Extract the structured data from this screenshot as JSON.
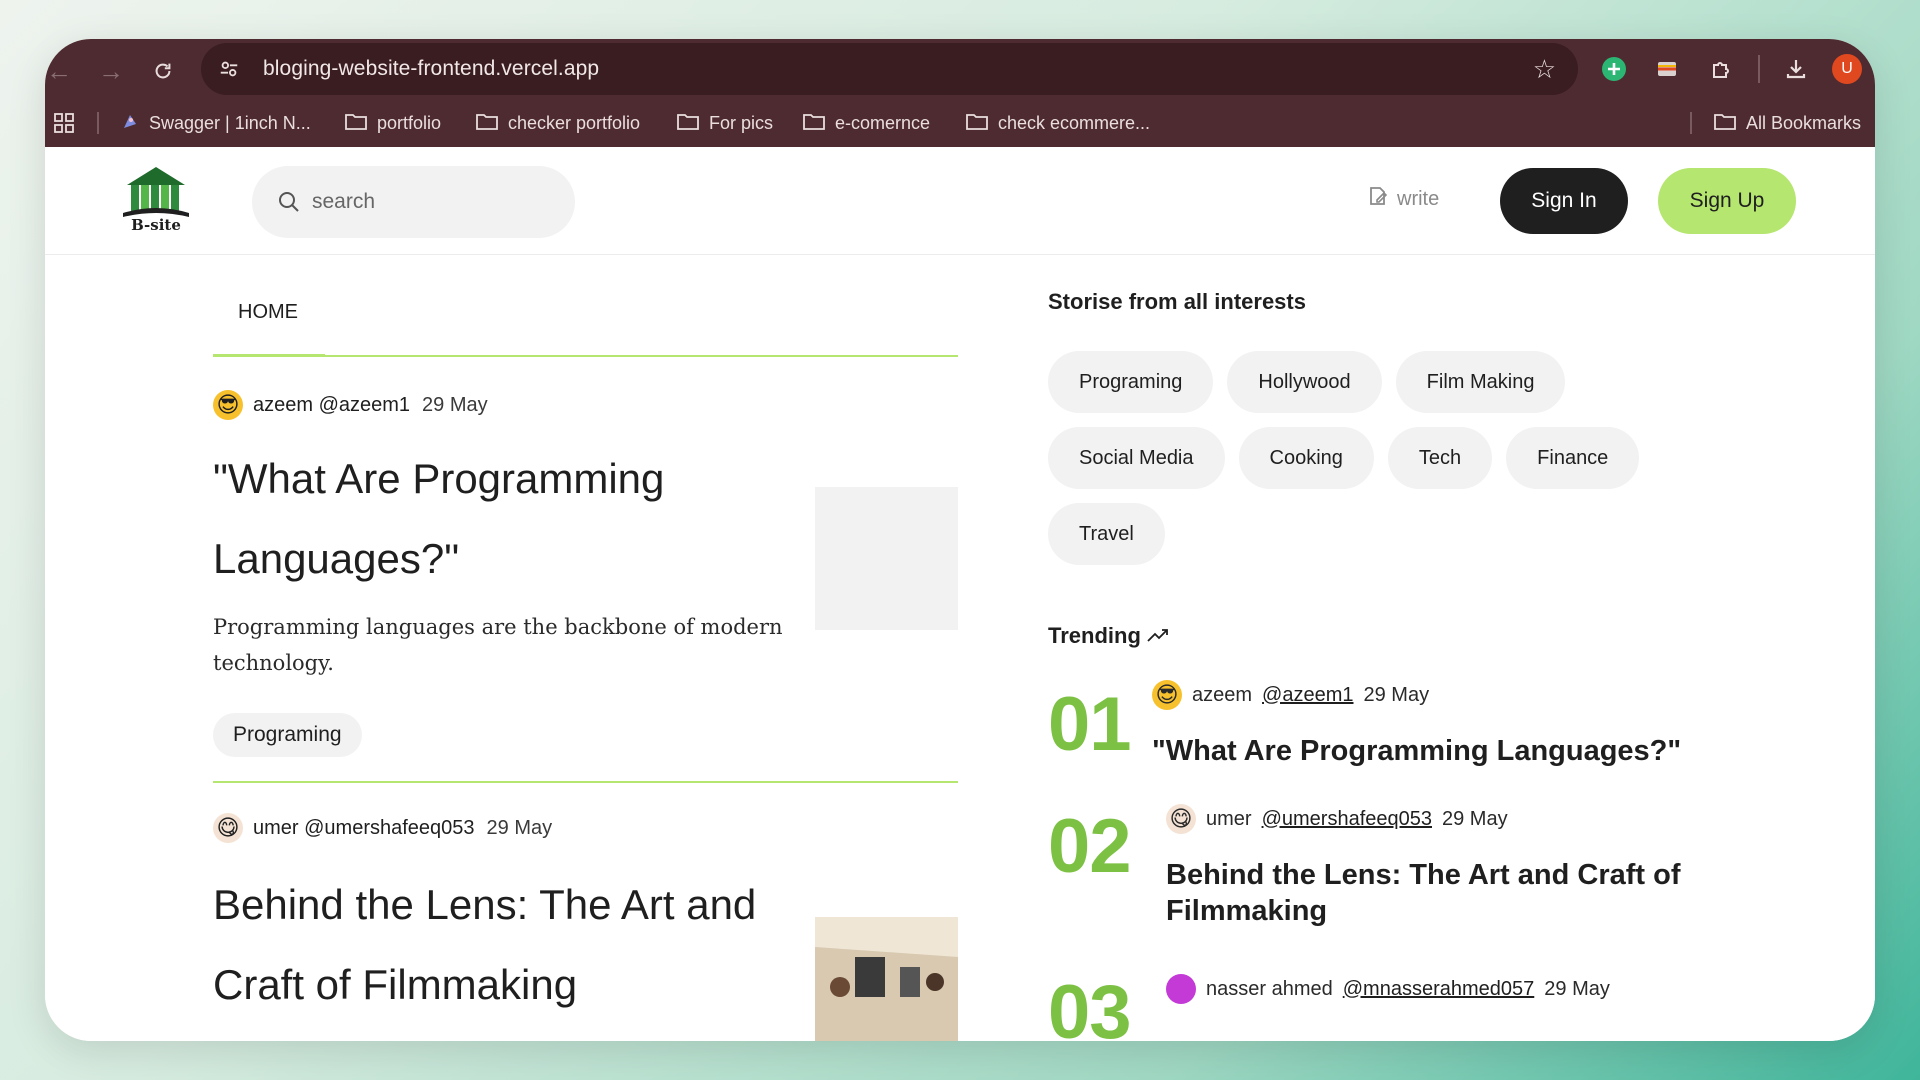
{
  "browser": {
    "url": "bloging-website-frontend.vercel.app",
    "profile_initial": "U",
    "bookmarks": [
      {
        "label": "Swagger | 1inch N..."
      },
      {
        "label": "portfolio"
      },
      {
        "label": "checker portfolio"
      },
      {
        "label": "For pics"
      },
      {
        "label": "e-comernce"
      },
      {
        "label": "check ecommere..."
      }
    ],
    "all_bookmarks": "All Bookmarks"
  },
  "header": {
    "logo_text": "B-site",
    "search_placeholder": "search",
    "write_label": "write",
    "signin_label": "Sign In",
    "signup_label": "Sign Up"
  },
  "feed": {
    "tab": "HOME",
    "posts": [
      {
        "author": "azeem @azeem1",
        "date": "29 May",
        "title": "\"What Are Programming Languages?\"",
        "description": "Programming languages are the backbone of modern technology.",
        "tag": "Programing"
      },
      {
        "author": "umer @umershafeeq053",
        "date": "29 May",
        "title": "Behind the Lens: The Art and Craft of Filmmaking"
      }
    ]
  },
  "aside": {
    "interests_title": "Storise from all interests",
    "interests": [
      "Programing",
      "Hollywood",
      "Film Making",
      "Social Media",
      "Cooking",
      "Tech",
      "Finance",
      "Travel"
    ],
    "trending_title": "Trending",
    "trending": [
      {
        "num": "01",
        "name": "azeem",
        "handle": "@azeem1",
        "date": "29 May",
        "title": "\"What Are Programming Languages?\""
      },
      {
        "num": "02",
        "name": "umer",
        "handle": "@umershafeeq053",
        "date": "29 May",
        "title": "Behind the Lens: The Art and Craft of Filmmaking"
      },
      {
        "num": "03",
        "name": "nasser ahmed",
        "handle": "@mnasserahmed057",
        "date": "29 May",
        "title": ""
      }
    ]
  },
  "colors": {
    "accent_green": "#b5e66f",
    "trend_green": "#7cc143",
    "chrome": "#4e2b30"
  }
}
